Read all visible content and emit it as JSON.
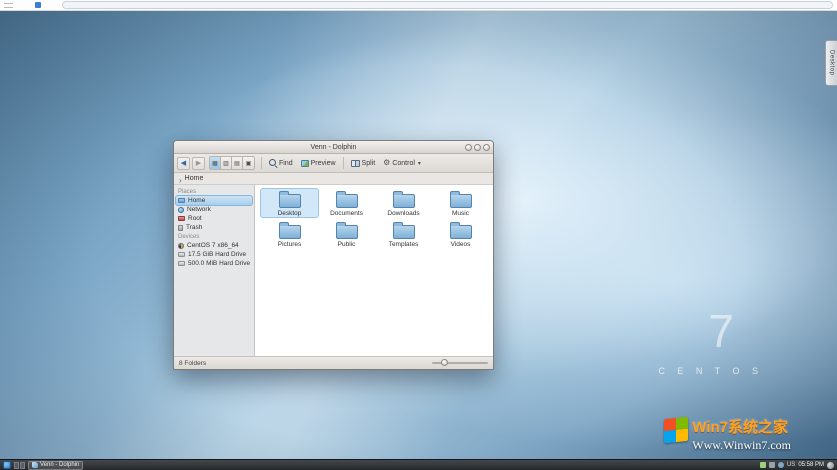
{
  "topbar": {
    "address_value": ""
  },
  "desktop": {
    "tab_label": "Desktop",
    "wallpaper_numeral": "7",
    "wallpaper_brand": "C E N T O S"
  },
  "window": {
    "title": "Venn - Dolphin",
    "toolbar": {
      "find_label": "Find",
      "preview_label": "Preview",
      "split_label": "Split",
      "control_label": "Control"
    },
    "breadcrumb": {
      "location": "Home"
    },
    "sidebar": {
      "places_header": "Places",
      "places": [
        {
          "label": "Home"
        },
        {
          "label": "Network"
        },
        {
          "label": "Root"
        },
        {
          "label": "Trash"
        }
      ],
      "devices_header": "Devices",
      "devices": [
        {
          "label": "CentOS 7 x86_64"
        },
        {
          "label": "17.5 GiB Hard Drive"
        },
        {
          "label": "500.0 MiB Hard Drive"
        }
      ]
    },
    "folders": [
      {
        "name": "Desktop"
      },
      {
        "name": "Documents"
      },
      {
        "name": "Downloads"
      },
      {
        "name": "Music"
      },
      {
        "name": "Pictures"
      },
      {
        "name": "Public"
      },
      {
        "name": "Templates"
      },
      {
        "name": "Videos"
      }
    ],
    "statusbar": {
      "items_text": "8 Folders"
    }
  },
  "taskbar": {
    "task_label": "Venn - Dolphin",
    "keyboard_layout": "US",
    "clock": "05:58 PM"
  },
  "watermark": {
    "title": "Win7系统之家",
    "url": "Www.Winwin7.com"
  },
  "colors": {
    "selection_blue": "#a9cdec",
    "folder_blue": "#7fb0d9",
    "watermark_orange": "#ffa21f",
    "taskbar_dark": "#2b2f33"
  }
}
